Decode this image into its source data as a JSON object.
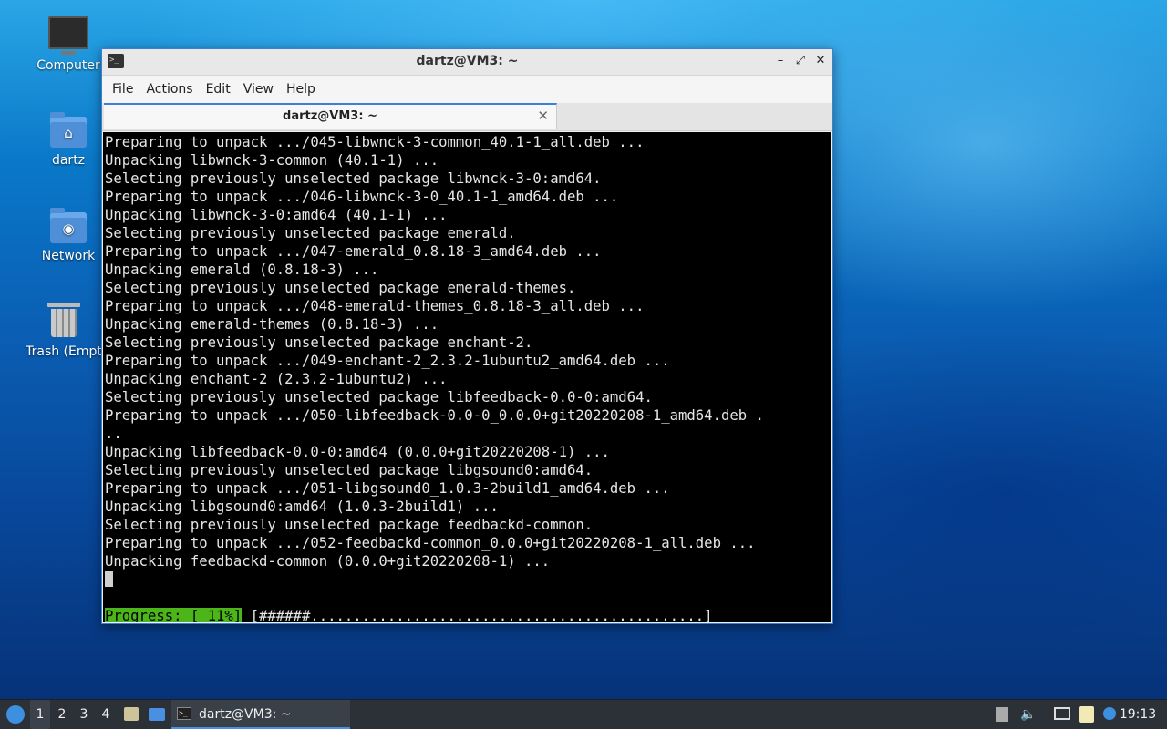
{
  "desktop": {
    "icons": [
      {
        "label": "Computer",
        "icon": "computer-icon"
      },
      {
        "label": "dartz",
        "icon": "home-folder-icon"
      },
      {
        "label": "Network",
        "icon": "network-folder-icon"
      },
      {
        "label": "Trash (Empt",
        "icon": "trash-icon"
      }
    ]
  },
  "window": {
    "title": "dartz@VM3: ~",
    "menu": [
      "File",
      "Actions",
      "Edit",
      "View",
      "Help"
    ],
    "tab_title": "dartz@VM3: ~",
    "controls": {
      "minimize": "–",
      "maximize": "⤢",
      "close": "✕"
    }
  },
  "terminal": {
    "lines": [
      "Preparing to unpack .../045-libwnck-3-common_40.1-1_all.deb ...",
      "Unpacking libwnck-3-common (40.1-1) ...",
      "Selecting previously unselected package libwnck-3-0:amd64.",
      "Preparing to unpack .../046-libwnck-3-0_40.1-1_amd64.deb ...",
      "Unpacking libwnck-3-0:amd64 (40.1-1) ...",
      "Selecting previously unselected package emerald.",
      "Preparing to unpack .../047-emerald_0.8.18-3_amd64.deb ...",
      "Unpacking emerald (0.8.18-3) ...",
      "Selecting previously unselected package emerald-themes.",
      "Preparing to unpack .../048-emerald-themes_0.8.18-3_all.deb ...",
      "Unpacking emerald-themes (0.8.18-3) ...",
      "Selecting previously unselected package enchant-2.",
      "Preparing to unpack .../049-enchant-2_2.3.2-1ubuntu2_amd64.deb ...",
      "Unpacking enchant-2 (2.3.2-1ubuntu2) ...",
      "Selecting previously unselected package libfeedback-0.0-0:amd64.",
      "Preparing to unpack .../050-libfeedback-0.0-0_0.0.0+git20220208-1_amd64.deb .",
      "..",
      "Unpacking libfeedback-0.0-0:amd64 (0.0.0+git20220208-1) ...",
      "Selecting previously unselected package libgsound0:amd64.",
      "Preparing to unpack .../051-libgsound0_1.0.3-2build1_amd64.deb ...",
      "Unpacking libgsound0:amd64 (1.0.3-2build1) ...",
      "Selecting previously unselected package feedbackd-common.",
      "Preparing to unpack .../052-feedbackd-common_0.0.0+git20220208-1_all.deb ...",
      "Unpacking feedbackd-common (0.0.0+git20220208-1) ..."
    ],
    "progress_label": "Progress: [ 11%]",
    "progress_bar": "[######..............................................]"
  },
  "taskbar": {
    "workspaces": [
      "1",
      "2",
      "3",
      "4"
    ],
    "active_workspace": "1",
    "task_label": "dartz@VM3: ~",
    "clock": "19:13"
  }
}
